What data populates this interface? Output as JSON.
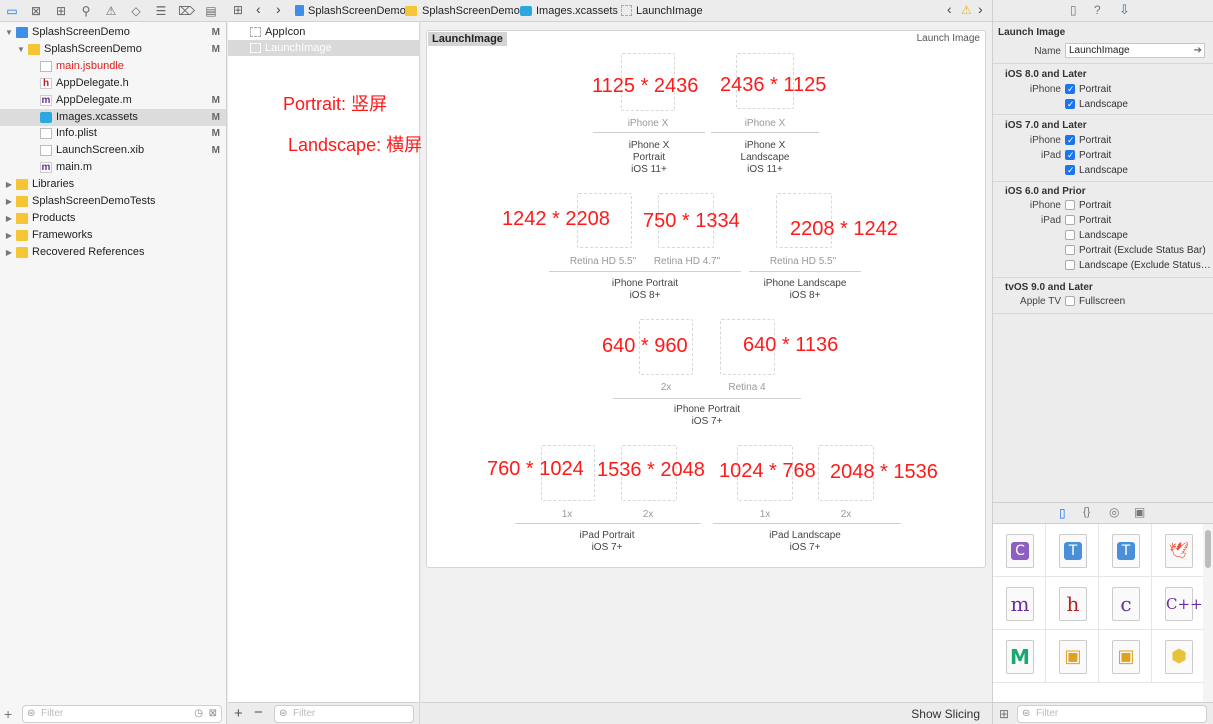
{
  "navigator": {
    "tree": [
      {
        "label": "SplashScreenDemo",
        "badge": "M",
        "icon": "project-icon",
        "depth": 0,
        "disclosure": "▼"
      },
      {
        "label": "SplashScreenDemo",
        "badge": "M",
        "icon": "folder-icon",
        "depth": 1,
        "disclosure": "▼"
      },
      {
        "label": "main.jsbundle",
        "badge": "",
        "icon": "file-icon",
        "depth": 2,
        "red": true
      },
      {
        "label": "AppDelegate.h",
        "badge": "",
        "icon": "h-file-icon",
        "depth": 2
      },
      {
        "label": "AppDelegate.m",
        "badge": "M",
        "icon": "m-file-icon",
        "depth": 2
      },
      {
        "label": "Images.xcassets",
        "badge": "M",
        "icon": "xcassets-icon",
        "depth": 2,
        "selected": true
      },
      {
        "label": "Info.plist",
        "badge": "M",
        "icon": "plist-icon",
        "depth": 2
      },
      {
        "label": "LaunchScreen.xib",
        "badge": "M",
        "icon": "xib-icon",
        "depth": 2
      },
      {
        "label": "main.m",
        "badge": "",
        "icon": "m-file-icon",
        "depth": 2
      },
      {
        "label": "Libraries",
        "badge": "",
        "icon": "folder-icon",
        "depth": 0,
        "disclosure": "▶"
      },
      {
        "label": "SplashScreenDemoTests",
        "badge": "",
        "icon": "folder-icon",
        "depth": 0,
        "disclosure": "▶"
      },
      {
        "label": "Products",
        "badge": "",
        "icon": "folder-icon",
        "depth": 0,
        "disclosure": "▶"
      },
      {
        "label": "Frameworks",
        "badge": "",
        "icon": "folder-icon",
        "depth": 0,
        "disclosure": "▶"
      },
      {
        "label": "Recovered References",
        "badge": "",
        "icon": "folder-icon",
        "depth": 0,
        "disclosure": "▶"
      }
    ],
    "filter_placeholder": "Filter"
  },
  "jumpbar": {
    "crumbs": [
      "SplashScreenDemo",
      "SplashScreenDemo",
      "Images.xcassets",
      "LaunchImage"
    ]
  },
  "assets": {
    "items": [
      {
        "label": "AppIcon",
        "selected": false
      },
      {
        "label": "LaunchImage",
        "selected": true
      }
    ],
    "filter_placeholder": "Filter"
  },
  "annotations": {
    "portrait": "Portrait: 竖屏",
    "landscape": "Landscape: 横屏"
  },
  "editor": {
    "title": "LaunchImage",
    "kind": "Launch Image",
    "show_slicing": "Show Slicing",
    "slots": [
      {
        "label": "iPhone X",
        "note": "1125 * 2436"
      },
      {
        "label": "iPhone X",
        "note": "2436 * 1125"
      },
      {
        "label": "Retina HD 5.5\"",
        "note": "1242 * 2208"
      },
      {
        "label": "Retina HD 4.7\"",
        "note": "750 * 1334"
      },
      {
        "label": "Retina HD 5.5\"",
        "note": "2208 * 1242"
      },
      {
        "label": "2x",
        "note": "640 * 960"
      },
      {
        "label": "Retina 4",
        "note": "640 * 1136"
      },
      {
        "label": "1x",
        "note": "760 * 1024"
      },
      {
        "label": "2x",
        "note": "1536 * 2048"
      },
      {
        "label": "1x",
        "note": "1024 * 768"
      },
      {
        "label": "2x",
        "note": "2048 * 1536"
      }
    ],
    "groups": [
      {
        "l1": "iPhone X",
        "l2": "Portrait",
        "l3": "iOS 11+"
      },
      {
        "l1": "iPhone X",
        "l2": "Landscape",
        "l3": "iOS 11+"
      },
      {
        "l1": "iPhone Portrait",
        "l2": "iOS 8+",
        "l3": ""
      },
      {
        "l1": "iPhone Landscape",
        "l2": "iOS 8+",
        "l3": ""
      },
      {
        "l1": "iPhone Portrait",
        "l2": "iOS 7+",
        "l3": ""
      },
      {
        "l1": "iPad Portrait",
        "l2": "iOS 7+",
        "l3": ""
      },
      {
        "l1": "iPad Landscape",
        "l2": "iOS 7+",
        "l3": ""
      }
    ]
  },
  "inspector": {
    "section_title": "Launch Image",
    "name_label": "Name",
    "name_value": "LaunchImage",
    "ios8": {
      "title": "iOS 8.0 and Later",
      "device": "iPhone",
      "portrait": "Portrait",
      "landscape": "Landscape"
    },
    "ios7": {
      "title": "iOS 7.0 and Later",
      "iphone": "iPhone",
      "ipad": "iPad",
      "portrait": "Portrait",
      "portrait2": "Portrait",
      "landscape": "Landscape"
    },
    "ios6": {
      "title": "iOS 6.0 and Prior",
      "iphone": "iPhone",
      "ipad": "iPad",
      "portrait": "Portrait",
      "portrait2": "Portrait",
      "landscape": "Landscape",
      "portrait_excl": "Portrait (Exclude Status Bar)",
      "landscape_excl": "Landscape (Exclude Status…"
    },
    "tvos": {
      "title": "tvOS 9.0 and Later",
      "device": "Apple TV",
      "fullscreen": "Fullscreen"
    },
    "library": [
      "C",
      "T",
      "T",
      "swift",
      "m",
      "h",
      "c",
      "C++",
      "metal",
      "asset",
      "asset",
      "cube"
    ],
    "filter_placeholder": "Filter"
  }
}
